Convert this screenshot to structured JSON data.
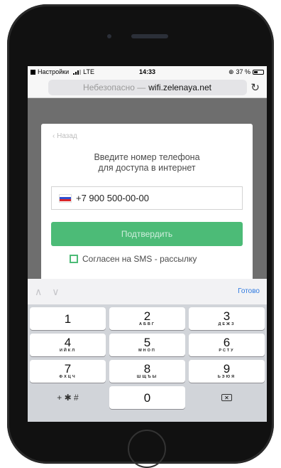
{
  "status_bar": {
    "back_app": "Настройки",
    "network": "LTE",
    "time": "14:33",
    "battery": "37 %"
  },
  "url_bar": {
    "insecure_label": "Небезопасно —",
    "domain": "wifi.zelenaya.net",
    "reload_icon": "↻"
  },
  "form": {
    "back_link": "‹ Назад",
    "heading_line1": "Введите номер телефона",
    "heading_line2": "для доступа в интернет",
    "phone_value": "+7 900 500-00-00",
    "confirm_label": "Подтвердить",
    "sms_consent_label": "Согласен на SMS - рассылку",
    "accent_color": "#4cbb77"
  },
  "keyboard": {
    "up_arrow": "∧",
    "down_arrow": "∨",
    "done_label": "Готово",
    "keys": [
      {
        "num": "1",
        "letters": ""
      },
      {
        "num": "2",
        "letters": "АБВГ"
      },
      {
        "num": "3",
        "letters": "ДЕЖЗ"
      },
      {
        "num": "4",
        "letters": "ИЙКЛ"
      },
      {
        "num": "5",
        "letters": "МНОП"
      },
      {
        "num": "6",
        "letters": "РСТУ"
      },
      {
        "num": "7",
        "letters": "ФХЦЧ"
      },
      {
        "num": "8",
        "letters": "ШЩЪЫ"
      },
      {
        "num": "9",
        "letters": "ЬЭЮЯ"
      }
    ],
    "symbols_key": "+ ✱ #",
    "zero_key": "0",
    "backspace_icon": "✕"
  }
}
